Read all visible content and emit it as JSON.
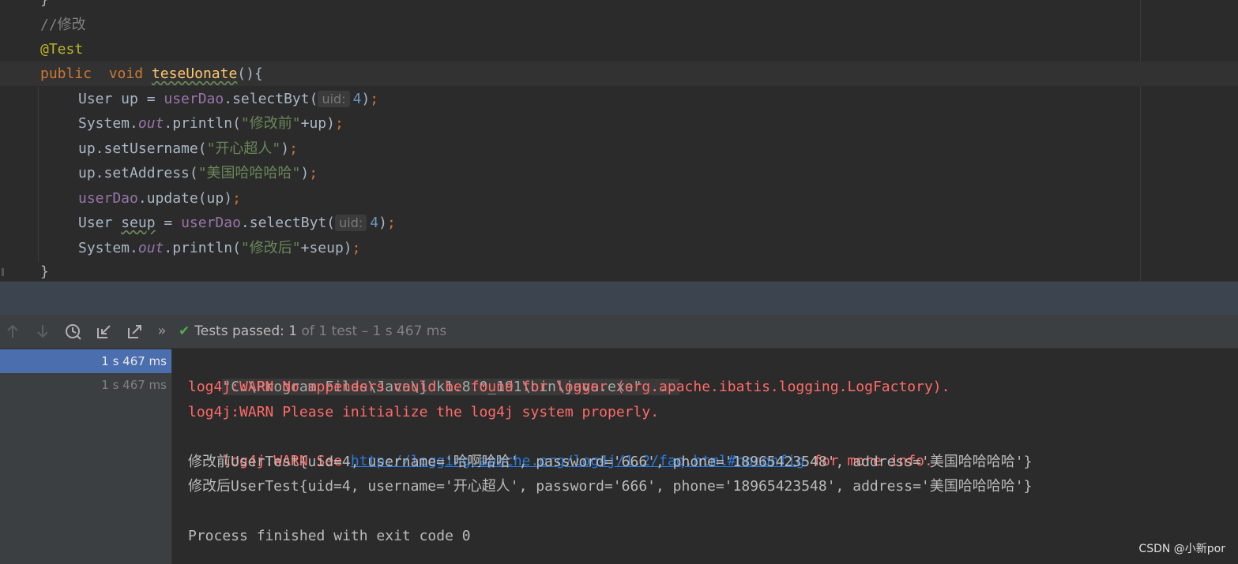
{
  "editor": {
    "lines": [
      {
        "closing_brace": "}"
      },
      {
        "comment": "//修改"
      },
      {
        "annotation": "@Test"
      },
      {
        "kw_public": "public",
        "kw_void": "void",
        "method": "teseUonate",
        "paren": "(){"
      },
      {
        "type": "User up = ",
        "field": "userDao",
        "call": ".selectByt(",
        "hint": "uid:",
        "num": "4",
        "end": ")",
        "semi": ";"
      },
      {
        "cls": "System.",
        "static": "out",
        "call": ".println(",
        "str": "\"修改前\"",
        "rest": "+up)",
        "semi": ";"
      },
      {
        "call": "up.setUsername(",
        "str": "\"开心超人\"",
        "rest": ")",
        "semi": ";"
      },
      {
        "call": "up.setAddress(",
        "str": "\"美国哈哈哈哈\"",
        "rest": ")",
        "semi": ";"
      },
      {
        "field": "userDao",
        "call": ".update(up)",
        "semi": ";"
      },
      {
        "type": "User ",
        "var": "seup",
        "eq": " = ",
        "field": "userDao",
        "call": ".selectByt(",
        "hint": "uid:",
        "num": "4",
        "end": ")",
        "semi": ";"
      },
      {
        "cls": "System.",
        "static": "out",
        "call": ".println(",
        "str": "\"修改后\"",
        "rest": "+seup)",
        "semi": ";"
      },
      {
        "closing_brace": "}"
      }
    ]
  },
  "toolbar": {
    "icons": [
      "arrow-up-icon",
      "arrow-down-icon",
      "history-clock-icon",
      "import-tests-icon",
      "export-tests-icon",
      "more-icon"
    ],
    "more_label": "»",
    "status_check": "✔",
    "status_main": "Tests passed: 1",
    "status_sub": " of 1 test – 1 s 467 ms"
  },
  "tree": {
    "rows": [
      "1 s 467 ms",
      "1 s 467 ms"
    ]
  },
  "console": {
    "cmd": "\"C:\\Program Files\\Java\\jdk1.8.0_191\\bin\\java.exe\" ...",
    "warn1": "log4j:WARN No appenders could be found for logger (org.apache.ibatis.logging.LogFactory).",
    "warn2": "log4j:WARN Please initialize the log4j system properly.",
    "warn3_pre": "log4j:WARN See ",
    "warn3_link": "http://logging.apache.org/log4j/1.2/faq.html#noconfig",
    "warn3_post": " for more info.",
    "out1": "修改前UserTest{uid=4, username='哈啊哈哈', password='666', phone='18965423548', address='美国哈哈哈哈'}",
    "out2": "修改后UserTest{uid=4, username='开心超人', password='666', phone='18965423548', address='美国哈哈哈哈'}",
    "exit": "Process finished with exit code 0"
  },
  "watermark": "CSDN @小新por",
  "colors": {
    "editor_bg": "#2b2b2b",
    "keyword": "#cc7832",
    "string": "#6a8759",
    "warn": "#ff6b68",
    "link": "#287bde",
    "selection": "#4b6eaf",
    "pass": "#4caf50"
  }
}
